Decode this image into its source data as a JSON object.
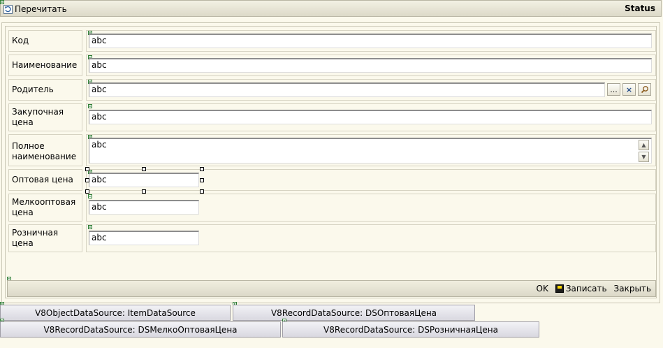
{
  "toolbar": {
    "refresh_label": "Перечитать",
    "status_title": "Status"
  },
  "fields": {
    "code": {
      "label": "Код",
      "value": "abc"
    },
    "name": {
      "label": "Наименование",
      "value": "abc"
    },
    "parent": {
      "label": "Родитель",
      "value": "abc",
      "select_label": "...",
      "clear_label": "×"
    },
    "purchase_price": {
      "label": "Закупочная цена",
      "value": "abc"
    },
    "full_name": {
      "label": "Полное наименование",
      "value": "abc"
    },
    "wholesale_price": {
      "label": "Оптовая цена",
      "value": "abc"
    },
    "small_wholesale_price": {
      "label": "Мелкооптовая цена",
      "value": "abc"
    },
    "retail_price": {
      "label": "Розничная цена",
      "value": "abc"
    }
  },
  "actions": {
    "ok": "OK",
    "save": "Записать",
    "close": "Закрыть"
  },
  "data_sources": [
    "V8ObjectDataSource: ItemDataSource",
    "V8RecordDataSource: DSОптоваяЦена",
    "V8RecordDataSource: DSМелкоОптоваяЦена",
    "V8RecordDataSource: DSРозничнаяЦена"
  ],
  "icons": {
    "refresh": "refresh-icon",
    "search": "magnifier-icon",
    "save": "floppy-disk-icon"
  }
}
